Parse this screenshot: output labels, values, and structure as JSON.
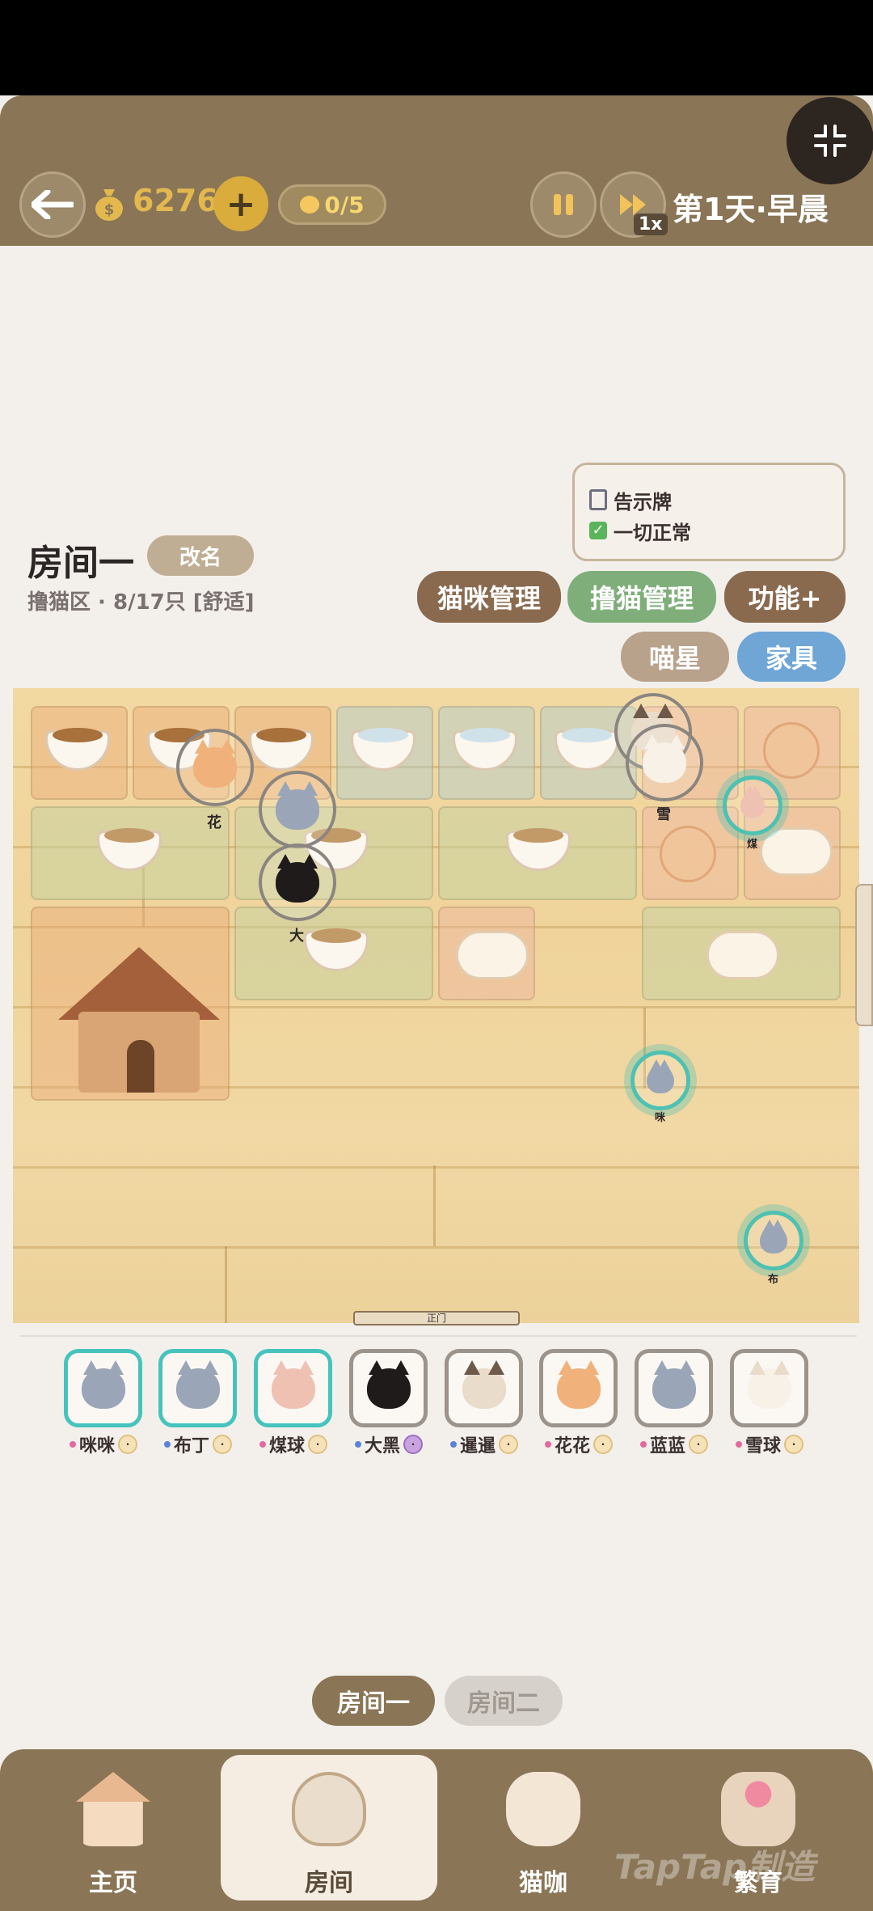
{
  "hud": {
    "back_icon": "arrow-left-icon",
    "coins": "6276",
    "coin_icon": "money-bag-icon",
    "add_icon": "plus-icon",
    "cat_capacity": "0/5",
    "speed": "1x",
    "day": "第1天·早晨"
  },
  "room": {
    "name": "房间一",
    "rename_label": "改名",
    "subtitle": "撸猫区 · 8/17只 [舒适]"
  },
  "sign": {
    "title": "告示牌",
    "status": "一切正常"
  },
  "actions": {
    "cat_manage": "猫咪管理",
    "pet_manage": "撸猫管理",
    "functions": "功能+",
    "meow_star": "喵星",
    "furniture": "家具"
  },
  "board": {
    "tokens": [
      "花",
      "雪",
      "煤",
      "大",
      "咪",
      "布"
    ],
    "door": "正门"
  },
  "cats": [
    {
      "name": "咪咪",
      "dot": "#e26aa0",
      "selected": true,
      "color": "#9aa6b8"
    },
    {
      "name": "布丁",
      "dot": "#5b82d6",
      "selected": true,
      "color": "#9aa6b8"
    },
    {
      "name": "煤球",
      "dot": "#e26aa0",
      "selected": true,
      "color": "#efc1b3"
    },
    {
      "name": "大黑",
      "dot": "#5b82d6",
      "selected": false,
      "color": "#1f1b1b"
    },
    {
      "name": "暹暹",
      "dot": "#5b82d6",
      "selected": false,
      "color": "#e9dccb"
    },
    {
      "name": "花花",
      "dot": "#e26aa0",
      "selected": false,
      "color": "#f0b27a"
    },
    {
      "name": "蓝蓝",
      "dot": "#e26aa0",
      "selected": false,
      "color": "#9aa6b8"
    },
    {
      "name": "雪球",
      "dot": "#e26aa0",
      "selected": false,
      "color": "#f7f1e8"
    }
  ],
  "room_tabs": [
    "房间一",
    "房间二"
  ],
  "nav": [
    "主页",
    "房间",
    "猫咖",
    "繁育"
  ],
  "watermark": "TapTap制造",
  "colors": {
    "hud_bg": "#8a7556",
    "gold": "#e2b84f",
    "accent_brown": "#8a6a4f",
    "accent_green": "#7fae7a",
    "accent_blue": "#6fa6d6",
    "selected_border": "#47c3bd"
  }
}
